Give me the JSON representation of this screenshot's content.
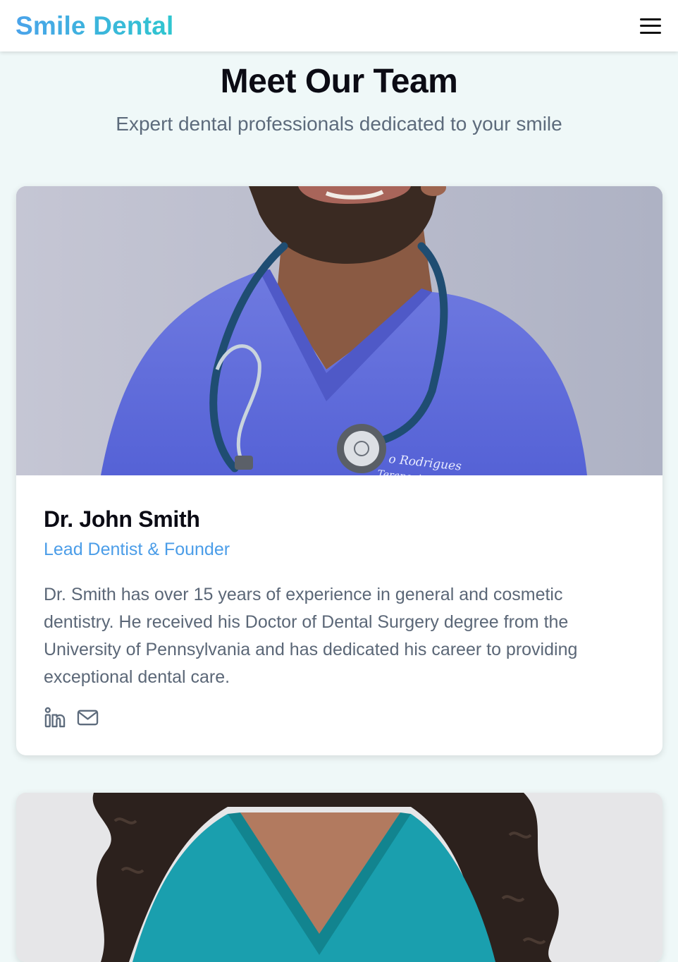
{
  "header": {
    "brand": "Smile Dental",
    "menu_icon": "hamburger-menu-icon"
  },
  "section": {
    "title": "Meet Our Team",
    "subtitle": "Expert dental professionals dedicated to your smile"
  },
  "team": [
    {
      "name": "Dr. John Smith",
      "role": "Lead Dentist & Founder",
      "bio": "Dr. Smith has over 15 years of experience in general and cosmetic dentistry. He received his Doctor of Dental Surgery degree from the University of Pennsylvania and has dedicated his career to providing exceptional dental care.",
      "photo": "dentist-photo-man-in-blue-scrubs",
      "socials": [
        "linkedin-icon",
        "email-icon"
      ]
    },
    {
      "photo": "dentist-photo-woman-in-teal-scrubs"
    }
  ],
  "colors": {
    "brand_gradient_start": "#4aa3ea",
    "brand_gradient_end": "#2fc6cf",
    "accent": "#4b9de8",
    "page_background": "#eff8f8"
  }
}
